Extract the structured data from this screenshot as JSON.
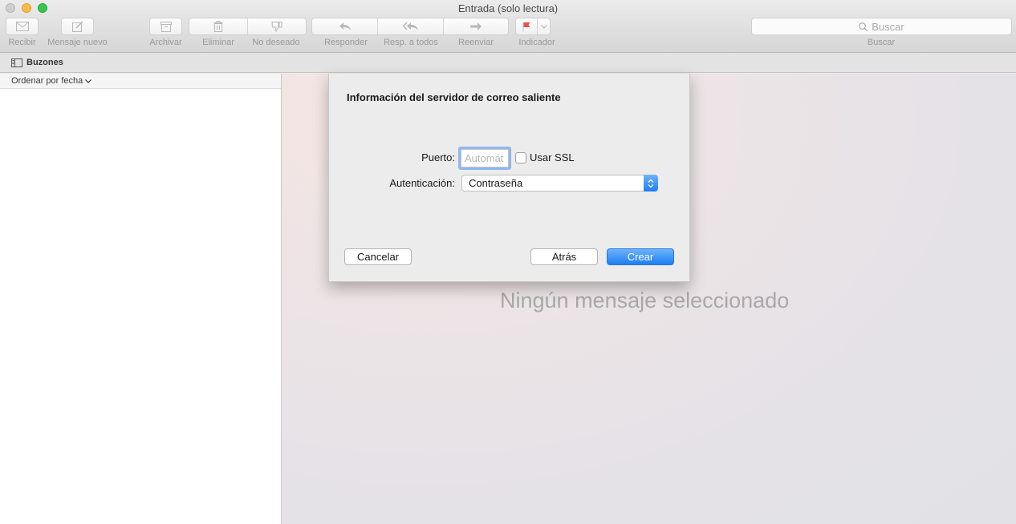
{
  "window": {
    "title": "Entrada (solo lectura)"
  },
  "toolbar": {
    "get_mail": "Recibir",
    "new_message": "Mensaje nuevo",
    "archive": "Archivar",
    "delete": "Eliminar",
    "junk": "No deseado",
    "reply": "Responder",
    "reply_all": "Resp. a todos",
    "forward": "Reenviar",
    "flag": "Indicador",
    "search_placeholder": "Buscar",
    "search_label": "Buscar"
  },
  "favorites": {
    "mailboxes": "Buzones"
  },
  "list": {
    "sort_label": "Ordenar por fecha"
  },
  "message_pane": {
    "empty_text": "Ningún mensaje seleccionado"
  },
  "sheet": {
    "title": "Información del servidor de correo saliente",
    "port_label": "Puerto:",
    "port_placeholder": "Automát",
    "port_value": "",
    "ssl_label": "Usar SSL",
    "ssl_checked": false,
    "auth_label": "Autenticación:",
    "auth_value": "Contraseña",
    "cancel": "Cancelar",
    "back": "Atrás",
    "create": "Crear"
  },
  "colors": {
    "accent": "#1e7ef3",
    "flag": "#e8524a"
  }
}
